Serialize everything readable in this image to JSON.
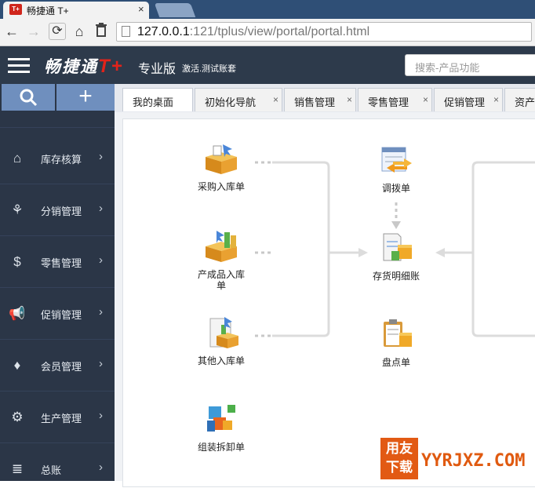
{
  "browser": {
    "tab_title": "畅捷通 T+",
    "tab_close": "×",
    "favicon_text": "T+",
    "url_host": "127.0.0.1",
    "url_rest": ":121/tplus/view/portal/portal.html",
    "icons": [
      "back-icon",
      "forward-icon",
      "reload-icon",
      "home-icon",
      "delete-icon",
      "page-icon"
    ]
  },
  "header": {
    "brand_text": "畅捷通",
    "brand_mark": "T+",
    "edition": "专业版",
    "account": "激活.测试账套",
    "search_placeholder": "搜索-产品功能"
  },
  "sidebar": {
    "items": [
      {
        "label": "库存核算",
        "icon": "warehouse-icon",
        "glyph": "⌂"
      },
      {
        "label": "分销管理",
        "icon": "distribution-icon",
        "glyph": "⚘"
      },
      {
        "label": "零售管理",
        "icon": "retail-icon",
        "glyph": "$"
      },
      {
        "label": "促销管理",
        "icon": "megaphone-icon",
        "glyph": "📢"
      },
      {
        "label": "会员管理",
        "icon": "member-icon",
        "glyph": "♦"
      },
      {
        "label": "生产管理",
        "icon": "gears-icon",
        "glyph": "⚙"
      },
      {
        "label": "总账",
        "icon": "ledger-icon",
        "glyph": "≣"
      }
    ],
    "arrow": "›"
  },
  "tabs": [
    {
      "label": "我的桌面",
      "close": ""
    },
    {
      "label": "初始化导航",
      "close": "×"
    },
    {
      "label": "销售管理",
      "close": "×"
    },
    {
      "label": "零售管理",
      "close": "×"
    },
    {
      "label": "促销管理",
      "close": "×"
    },
    {
      "label": "资产",
      "close": ""
    }
  ],
  "flow": {
    "nodes": [
      {
        "id": "purchase-receipt",
        "label": "采购入库单"
      },
      {
        "id": "product-receipt",
        "label": "产成品入库单"
      },
      {
        "id": "other-receipt",
        "label": "其他入库单"
      },
      {
        "id": "assembly",
        "label": "组装拆卸单"
      },
      {
        "id": "transfer",
        "label": "调拨单"
      },
      {
        "id": "inventory-ledger",
        "label": "存货明细账"
      },
      {
        "id": "stocktake",
        "label": "盘点单"
      }
    ]
  },
  "watermark": {
    "box_line1": "用友",
    "box_line2": "下载",
    "text": "YYRJXZ.COM"
  },
  "colors": {
    "browser_tabstrip": "#2f4f76",
    "app_header": "#2d3a4b",
    "sidebar": "#2b3647",
    "sidebar_buttons": "#6f8fbe",
    "brand_red": "#e2231a",
    "watermark_orange": "#e25a14"
  }
}
